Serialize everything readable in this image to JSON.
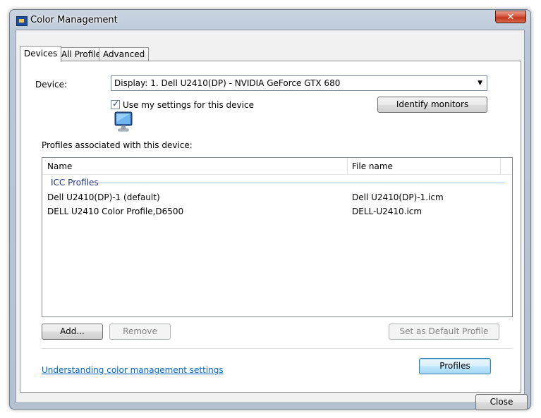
{
  "window": {
    "title": "Color Management",
    "close_glyph": "✕"
  },
  "tabs": [
    {
      "label": "Devices",
      "active": true
    },
    {
      "label": "All Profiles",
      "active": false
    },
    {
      "label": "Advanced",
      "active": false
    }
  ],
  "device": {
    "label": "Device:",
    "selected": "Display: 1. Dell U2410(DP) - NVIDIA GeForce GTX 680",
    "icon": "monitor-icon"
  },
  "use_my_settings": {
    "label": "Use my settings for this device",
    "checked": true
  },
  "identify_button": "Identify monitors",
  "profiles_section_label": "Profiles associated with this device:",
  "list": {
    "columns": [
      "Name",
      "File name"
    ],
    "group": "ICC Profiles",
    "rows": [
      {
        "name": "Dell U2410(DP)-1 (default)",
        "file": "Dell U2410(DP)-1.icm"
      },
      {
        "name": "DELL U2410 Color Profile,D6500",
        "file": "DELL-U2410.icm"
      }
    ]
  },
  "buttons": {
    "add": "Add...",
    "remove": "Remove",
    "set_default": "Set as Default Profile",
    "profiles": "Profiles",
    "close": "Close"
  },
  "help_link": "Understanding color management settings",
  "colors": {
    "link": "#0066cc",
    "group_title": "#1e3287",
    "close_button": "#c2361f"
  }
}
